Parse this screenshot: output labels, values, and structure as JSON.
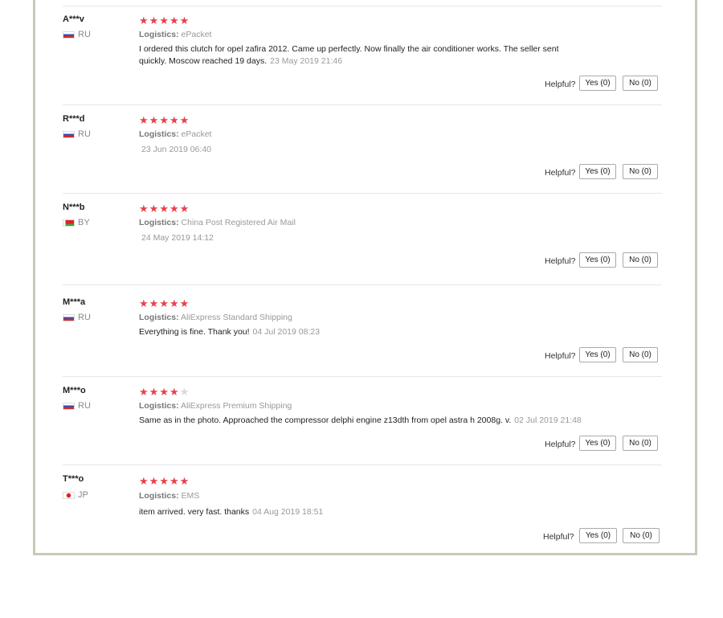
{
  "reviews": [
    {
      "user": "A***v",
      "country": "RU",
      "flag": "ru",
      "stars": 5,
      "logistics_label": "Logistics:",
      "logistics": "ePacket",
      "text": "I ordered this clutch for opel zafira 2012. Came up perfectly. Now finally the air conditioner works. The seller sent quickly. Moscow reached 19 days.",
      "date": "23 May 2019 21:46",
      "helpful": "Helpful?",
      "yes": "Yes (0)",
      "no": "No (0)"
    },
    {
      "user": "R***d",
      "country": "RU",
      "flag": "ru",
      "stars": 5,
      "logistics_label": "Logistics:",
      "logistics": "ePacket",
      "text": "",
      "date": "23 Jun 2019 06:40",
      "helpful": "Helpful?",
      "yes": "Yes (0)",
      "no": "No (0)"
    },
    {
      "user": "N***b",
      "country": "BY",
      "flag": "by",
      "stars": 5,
      "logistics_label": "Logistics:",
      "logistics": "China Post Registered Air Mail",
      "text": "",
      "date": "24 May 2019 14:12",
      "helpful": "Helpful?",
      "yes": "Yes (0)",
      "no": "No (0)"
    },
    {
      "user": "M***a",
      "country": "RU",
      "flag": "ru",
      "stars": 5,
      "logistics_label": "Logistics:",
      "logistics": "AliExpress Standard Shipping",
      "text": "Everything is fine. Thank you!",
      "date": "04 Jul 2019 08:23",
      "helpful": "Helpful?",
      "yes": "Yes (0)",
      "no": "No (0)"
    },
    {
      "user": "M***o",
      "country": "RU",
      "flag": "ru",
      "stars": 4,
      "logistics_label": "Logistics:",
      "logistics": "AliExpress Premium Shipping",
      "text": "Same as in the photo. Approached the compressor delphi engine z13dth from opel astra h 2008g. v.",
      "date": "02 Jul 2019 21:48",
      "helpful": "Helpful?",
      "yes": "Yes (0)",
      "no": "No (0)"
    },
    {
      "user": "T***o",
      "country": "JP",
      "flag": "jp",
      "stars": 5,
      "logistics_label": "Logistics:",
      "logistics": "EMS",
      "text": "item arrived. very fast. thanks",
      "date": "04 Aug 2019 18:51",
      "helpful": "Helpful?",
      "yes": "Yes (0)",
      "no": "No (0)"
    }
  ],
  "colors": {
    "star_on": "#e8404b",
    "star_off": "#d8d8d8",
    "frame": "#c9c9b8"
  }
}
